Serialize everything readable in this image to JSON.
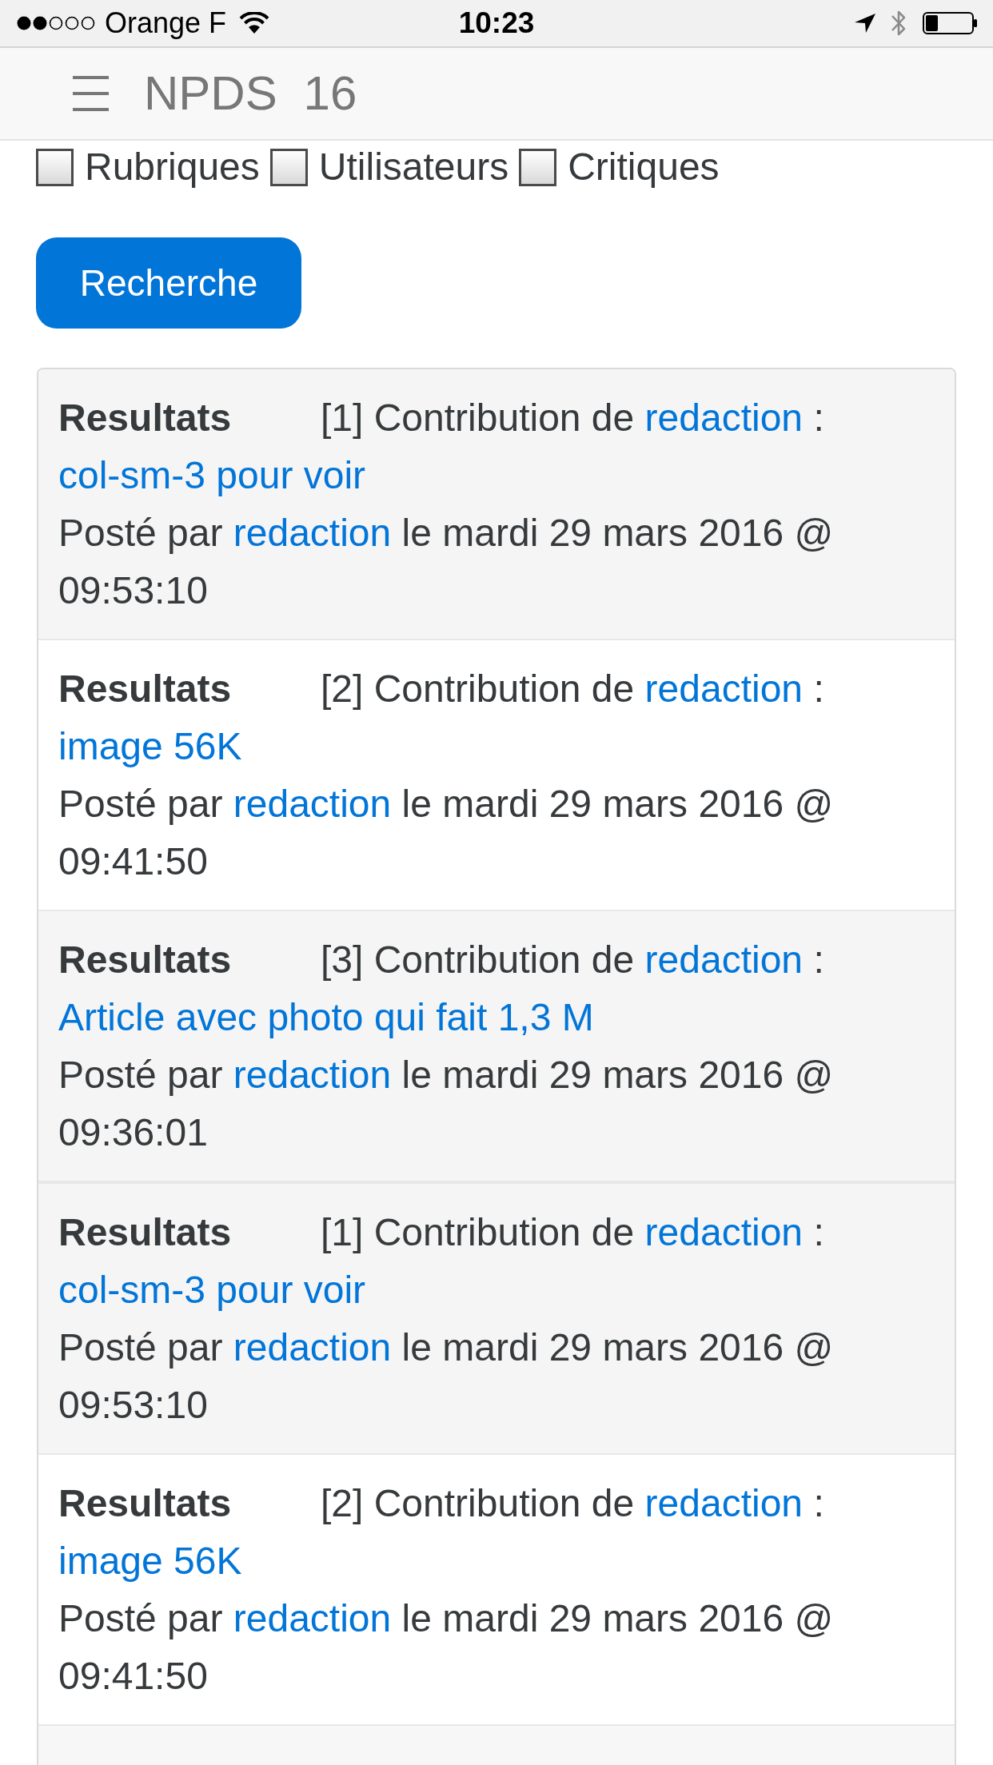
{
  "status_bar": {
    "carrier": "Orange F",
    "time": "10:23"
  },
  "navbar": {
    "title": "NPDS 16"
  },
  "filters": [
    {
      "label": "Rubriques",
      "checked": false
    },
    {
      "label": "Utilisateurs",
      "checked": false
    },
    {
      "label": "Critiques",
      "checked": false
    }
  ],
  "search_button": {
    "label": "Recherche"
  },
  "result_groups": [
    {
      "results": [
        {
          "label": "Resultats",
          "intro": "[1] Contribution de",
          "author": "redaction",
          "separator": ":",
          "title": "col-sm-3 pour voir",
          "posted_prefix": "Posté par",
          "poster": "redaction",
          "posted_suffix": "le mardi 29 mars 2016 @ 09:53:10"
        },
        {
          "label": "Resultats",
          "intro": "[2] Contribution de",
          "author": "redaction",
          "separator": ":",
          "title": "image 56K",
          "posted_prefix": "Posté par",
          "poster": "redaction",
          "posted_suffix": "le mardi 29 mars 2016 @ 09:41:50"
        },
        {
          "label": "Resultats",
          "intro": "[3] Contribution de",
          "author": "redaction",
          "separator": ":",
          "title": "Article avec photo qui fait 1,3 M",
          "posted_prefix": "Posté par",
          "poster": "redaction",
          "posted_suffix": "le mardi 29 mars 2016 @ 09:36:01"
        }
      ]
    },
    {
      "results": [
        {
          "label": "Resultats",
          "intro": "[1] Contribution de",
          "author": "redaction",
          "separator": ":",
          "title": "col-sm-3 pour voir",
          "posted_prefix": "Posté par",
          "poster": "redaction",
          "posted_suffix": "le mardi 29 mars 2016 @ 09:53:10"
        },
        {
          "label": "Resultats",
          "intro": "[2] Contribution de",
          "author": "redaction",
          "separator": ":",
          "title": "image 56K",
          "posted_prefix": "Posté par",
          "poster": "redaction",
          "posted_suffix": "le mardi 29 mars 2016 @ 09:41:50"
        }
      ]
    }
  ]
}
